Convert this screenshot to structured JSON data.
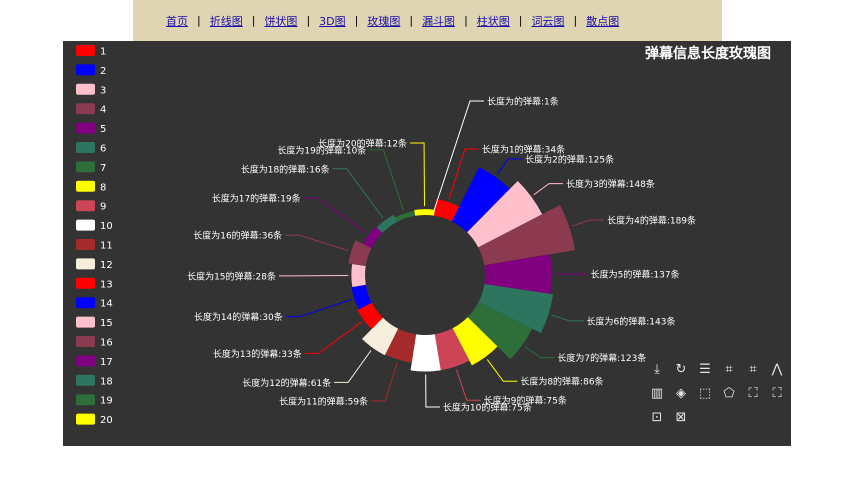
{
  "nav": {
    "links": [
      "首页",
      "折线图",
      "饼状图",
      "3D图",
      "玫瑰图",
      "漏斗图",
      "柱状图",
      "词云图",
      "散点图"
    ]
  },
  "chart_data": {
    "type": "pie",
    "variant": "rose (radius)",
    "title": "弹幕信息长度玫瑰图",
    "legend_position": "left",
    "categories": [
      "1",
      "2",
      "3",
      "4",
      "5",
      "6",
      "7",
      "8",
      "9",
      "10",
      "11",
      "12",
      "13",
      "14",
      "15",
      "16",
      "17",
      "18",
      "19",
      "20"
    ],
    "values": [
      34,
      125,
      148,
      189,
      137,
      143,
      123,
      86,
      75,
      75,
      59,
      61,
      33,
      30,
      28,
      36,
      19,
      16,
      10,
      12
    ],
    "labels": [
      "长度为1的弹幕:34条",
      "长度为2的弹幕:125条",
      "长度为3的弹幕:148条",
      "长度为4的弹幕:189条",
      "长度为5的弹幕:137条",
      "长度为6的弹幕:143条",
      "长度为7的弹幕:123条",
      "长度为8的弹幕:86条",
      "长度为9的弹幕:75条",
      "长度为10的弹幕:75条",
      "长度为11的弹幕:59条",
      "长度为12的弹幕:61条",
      "长度为13的弹幕:33条",
      "长度为14的弹幕:30条",
      "长度为15的弹幕:28条",
      "长度为16的弹幕:36条",
      "长度为17的弹幕:19条",
      "长度为18的弹幕:16条",
      "长度为19的弹幕:10条",
      "长度为20的弹幕:12条"
    ],
    "extra_label": "长度为的弹幕:1条",
    "colors": [
      "#ff0000",
      "#0000ff",
      "#ffc0cb",
      "#8b3a4f",
      "#800080",
      "#2e7560",
      "#2d6e3a",
      "#ffff00",
      "#cc4455",
      "#ffffff",
      "#a52a2a",
      "#f5eedc",
      "#ff0000",
      "#0000ff",
      "#ffc0cb",
      "#8b3a4f",
      "#800080",
      "#2e7560",
      "#2d6e3a",
      "#ffff00"
    ]
  },
  "toolbox": {
    "icons": [
      "save-image-icon",
      "restore-icon",
      "data-view-icon",
      "crop-icon",
      "crop-alt-icon",
      "line-icon",
      "bar-icon",
      "stack-icon",
      "select-rect-icon",
      "select-poly-icon",
      "expand-icon",
      "compress-icon",
      "zoom-icon",
      "zoom-reset-icon"
    ]
  }
}
